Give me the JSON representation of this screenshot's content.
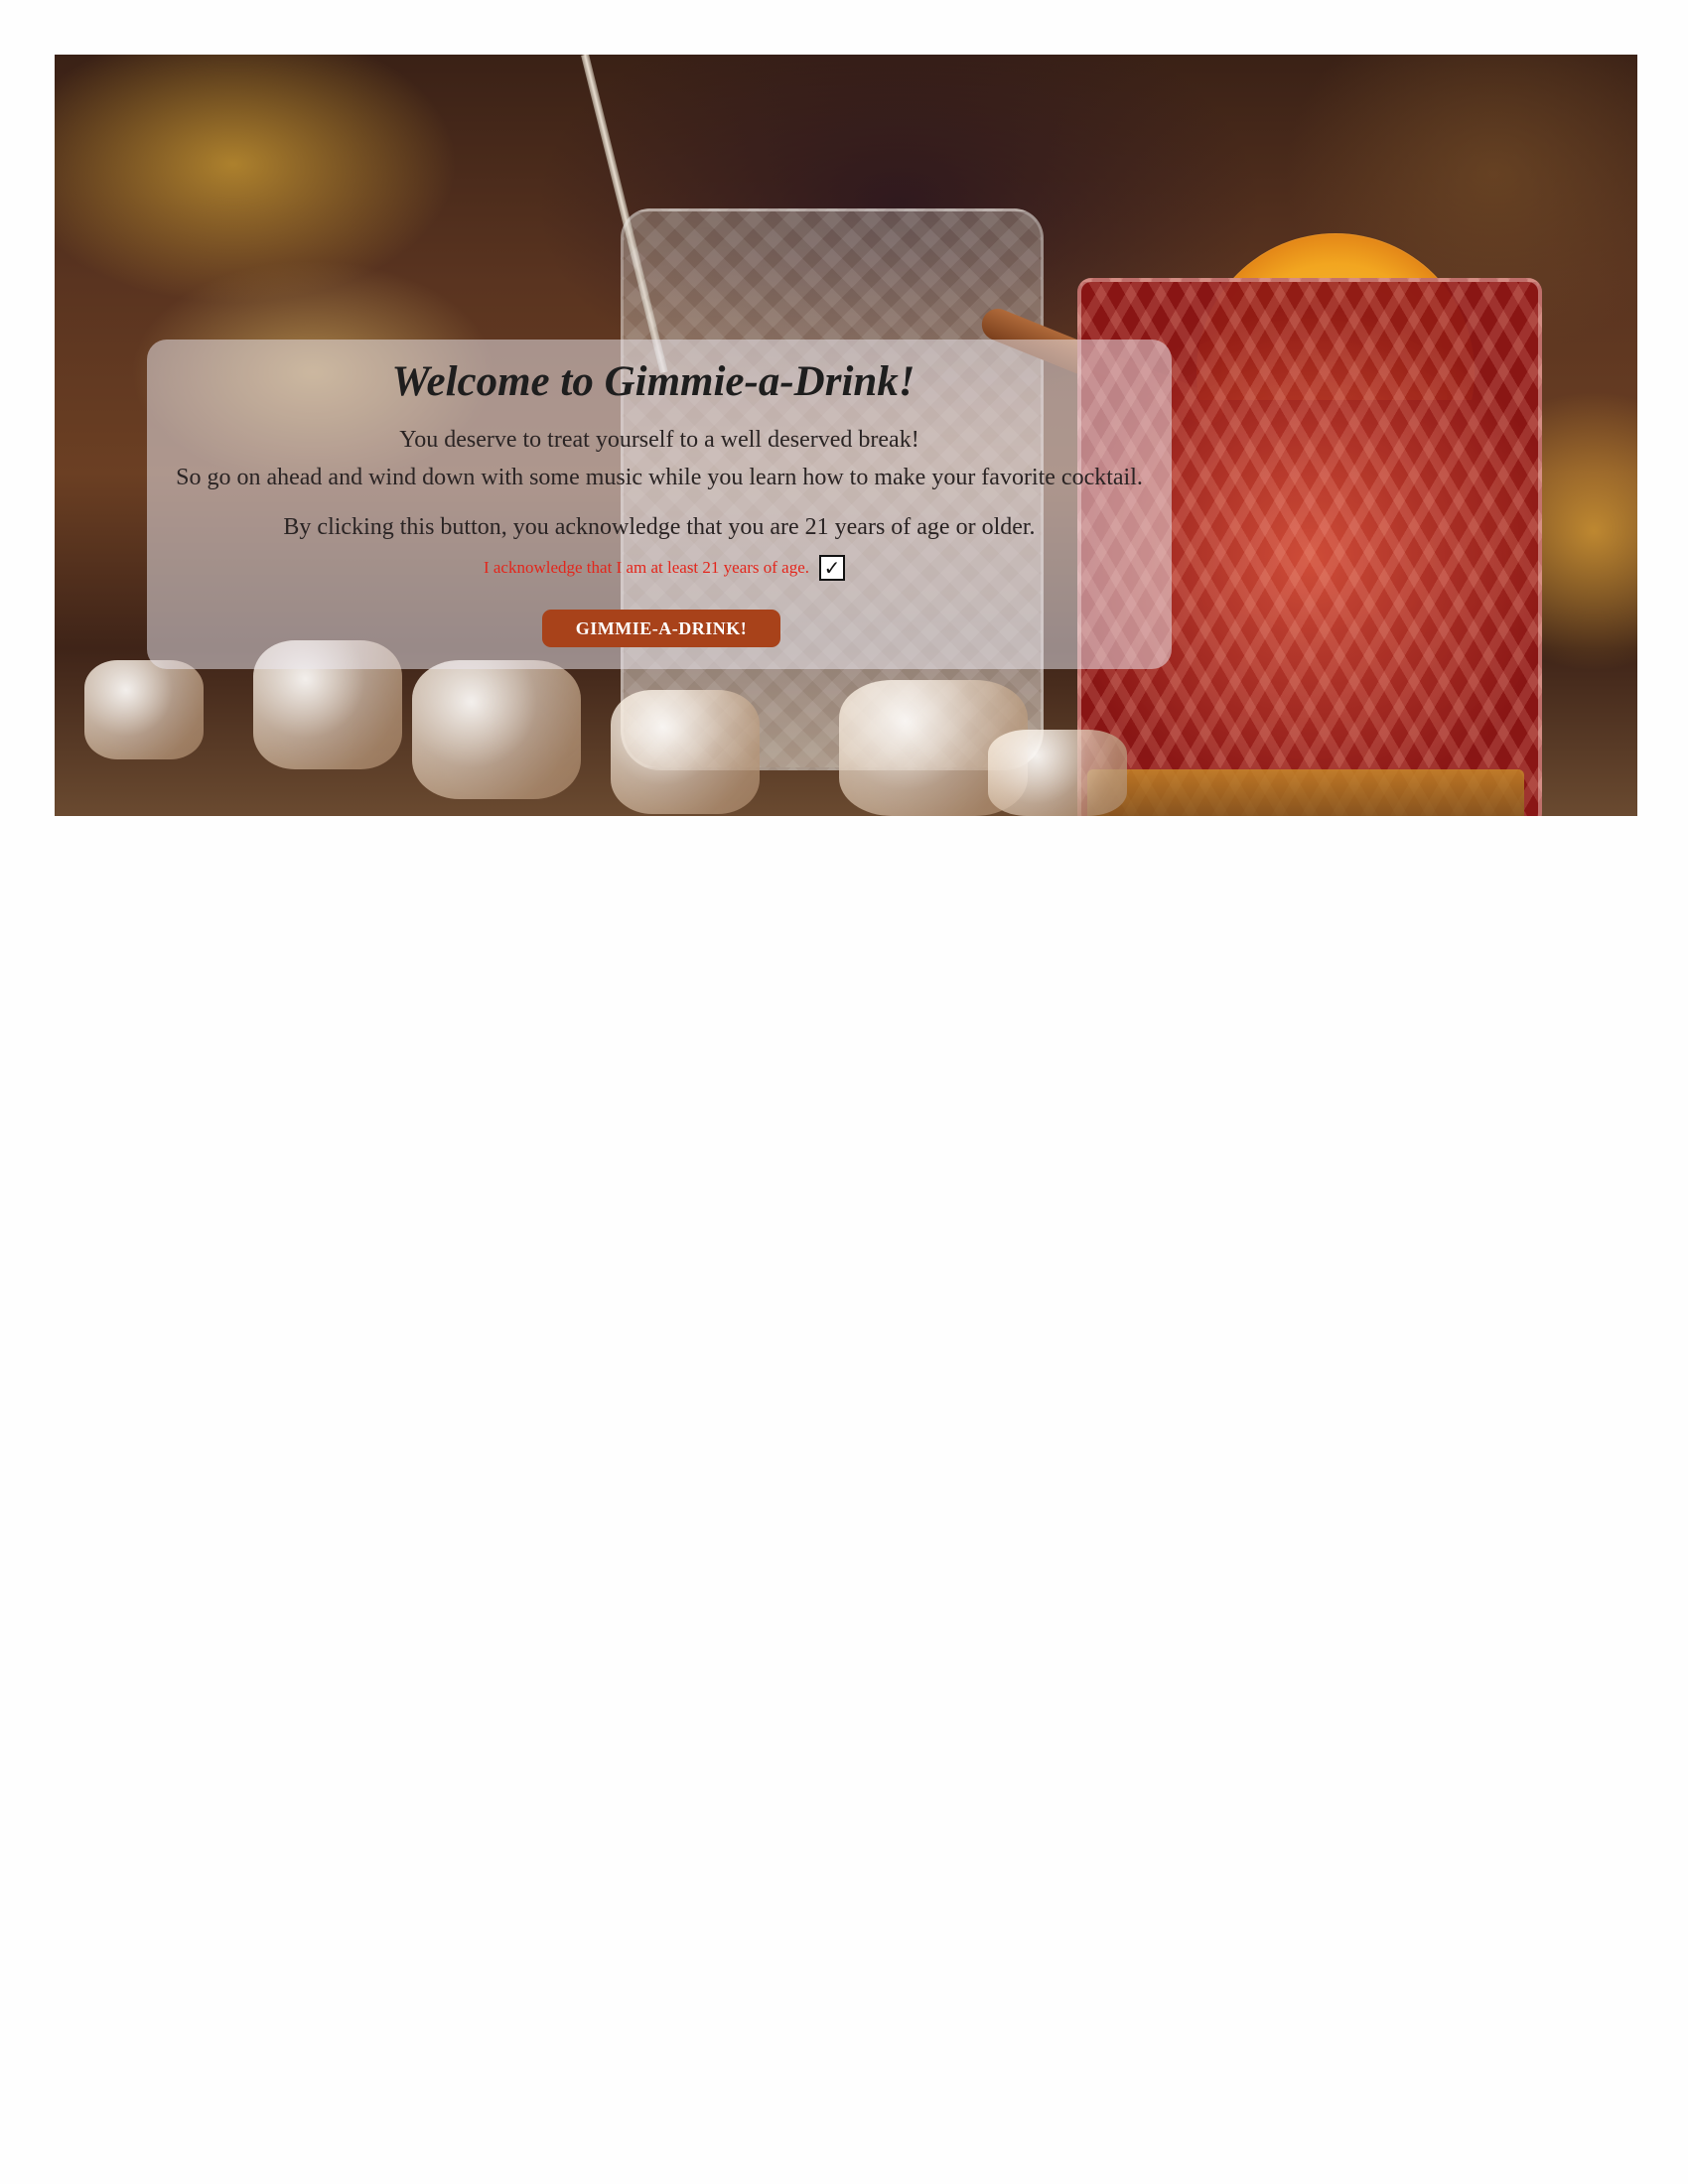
{
  "landing": {
    "title": "Welcome to Gimmie-a-Drink!",
    "line1": "You deserve to treat yourself to a well deserved break!",
    "line2": "So go on ahead and wind down with some music while you learn how to make your favorite cocktail.",
    "line3": "By clicking this button, you acknowledge that you are 21 years of age or older.",
    "acknowledge_label": "I acknowledge that I am at least 21 years of age.",
    "acknowledge_checked": true,
    "check_glyph": "✓",
    "button_label": "GIMMIE-A-DRINK!"
  },
  "colors": {
    "button_bg": "#a8421a",
    "acknowledge_text": "#e3261c"
  }
}
